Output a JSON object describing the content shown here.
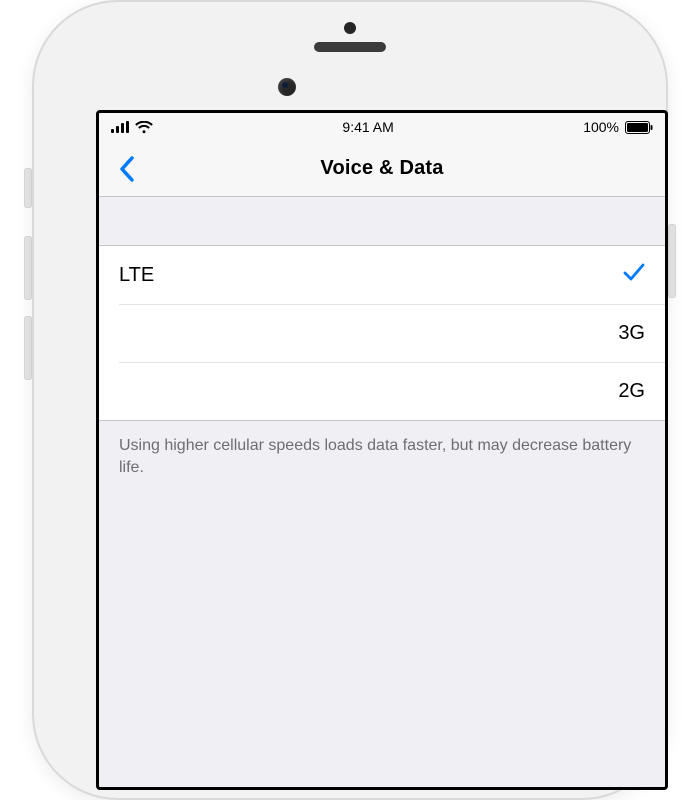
{
  "status_bar": {
    "time": "9:41 AM",
    "battery_pct": "100%"
  },
  "nav": {
    "title": "Voice & Data"
  },
  "options": [
    {
      "label": "LTE",
      "selected": true
    },
    {
      "label": "3G",
      "selected": false
    },
    {
      "label": "2G",
      "selected": false
    }
  ],
  "footer_note": "Using higher cellular speeds loads data faster, but may decrease battery life."
}
